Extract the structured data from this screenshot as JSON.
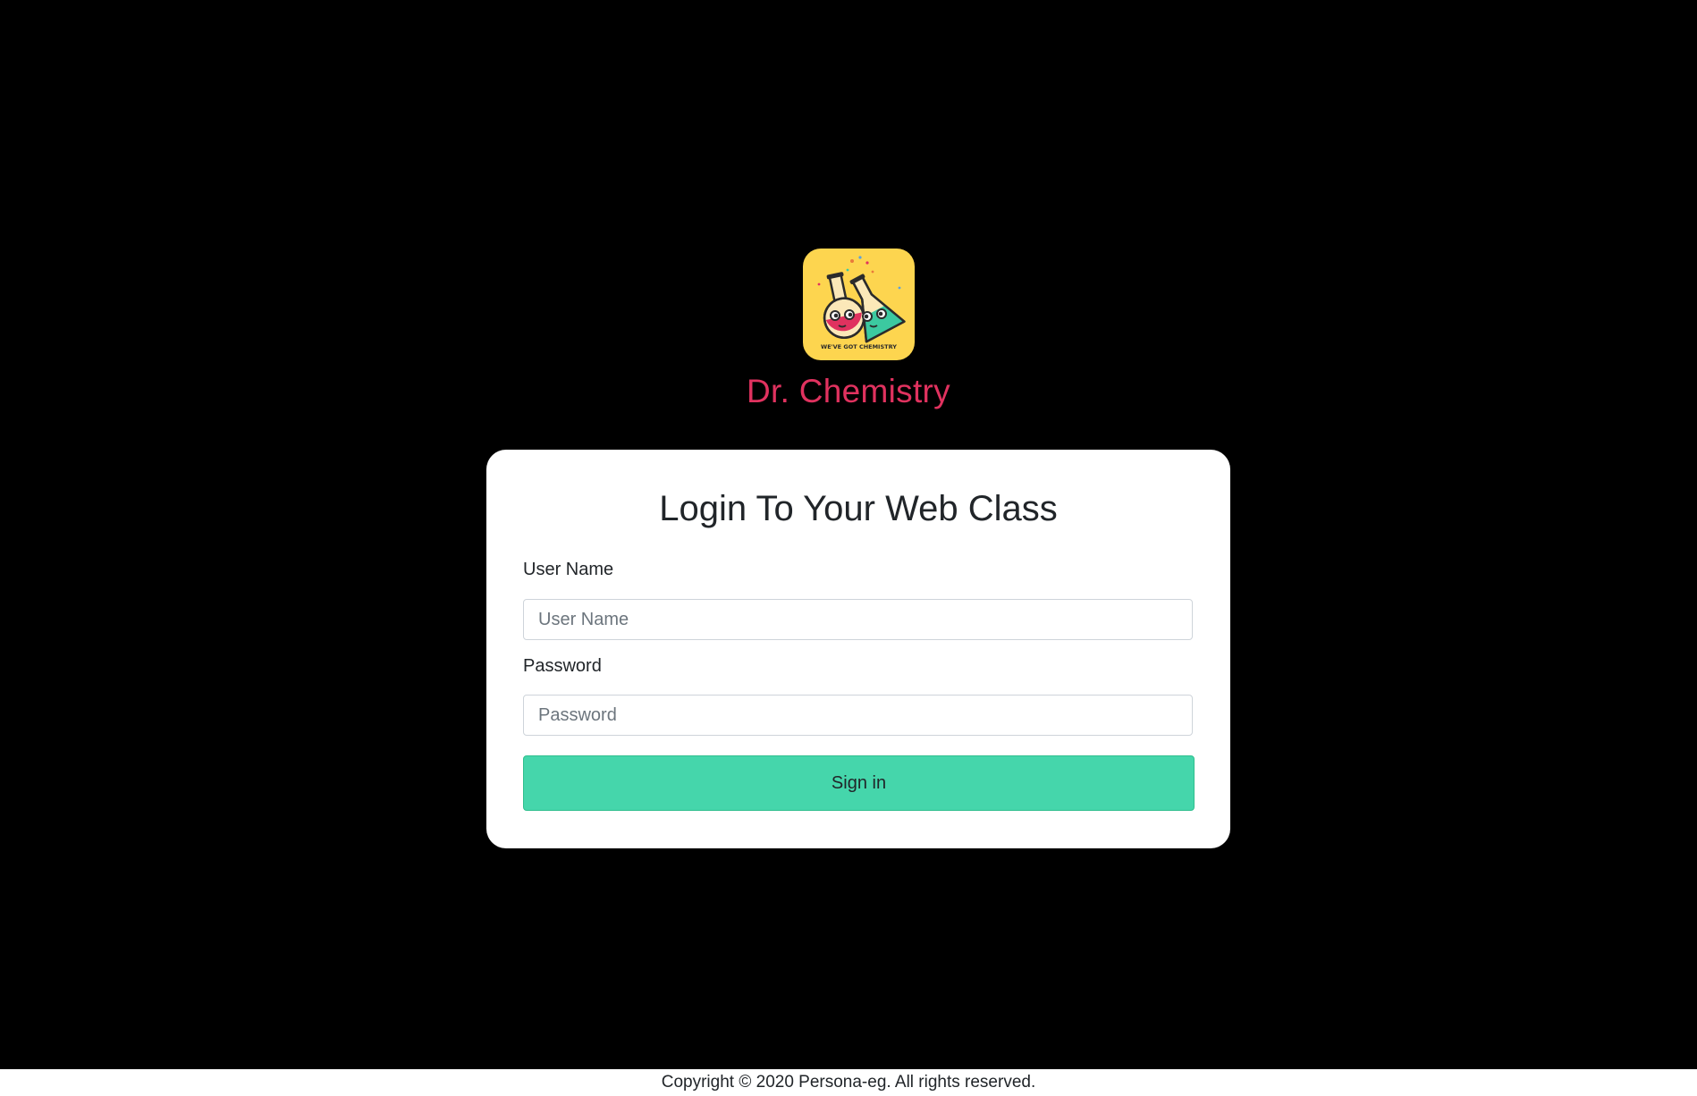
{
  "brand": {
    "name": "Dr. Chemistry",
    "logo_icon": "chemistry-flasks-logo",
    "logo_caption": "WE'VE GOT CHEMISTRY",
    "accent_color": "#e0325f",
    "logo_bg_color": "#fdd54f"
  },
  "login_form": {
    "title": "Login To Your Web Class",
    "username": {
      "label": "User Name",
      "placeholder": "User Name",
      "value": ""
    },
    "password": {
      "label": "Password",
      "placeholder": "Password",
      "value": ""
    },
    "submit_label": "Sign in",
    "submit_color": "#45d6ab"
  },
  "footer": {
    "copyright": "Copyright © 2020 Persona-eg. All rights reserved."
  }
}
